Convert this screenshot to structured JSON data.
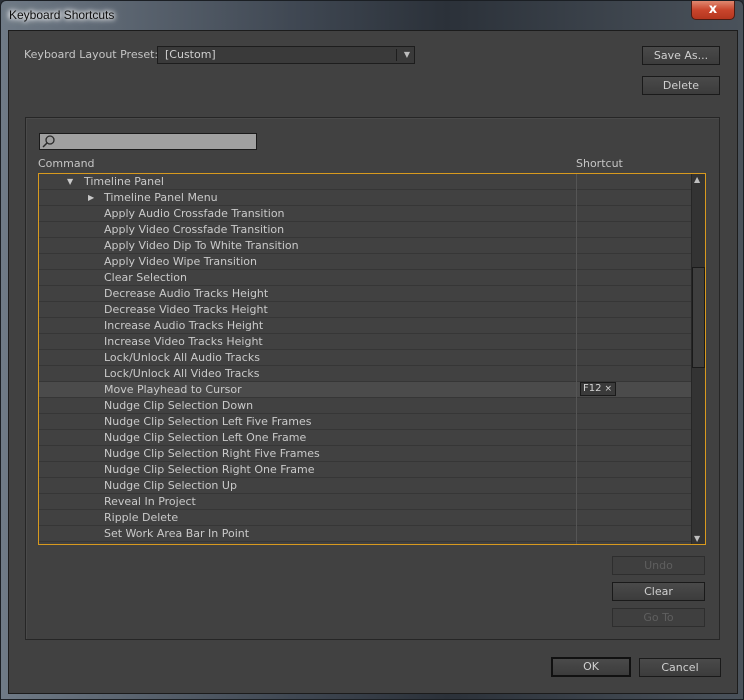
{
  "window": {
    "title": "Keyboard Shortcuts",
    "close_glyph": "x"
  },
  "preset": {
    "label": "Keyboard Layout Preset:",
    "value": "[Custom]",
    "arrow": "▼"
  },
  "buttons": {
    "save_as": "Save As...",
    "delete": "Delete",
    "undo": "Undo",
    "clear": "Clear",
    "go_to": "Go To",
    "ok": "OK",
    "cancel": "Cancel"
  },
  "search": {
    "placeholder": "",
    "value": "",
    "icon": "search-icon"
  },
  "table": {
    "columns": [
      "Command",
      "Shortcut"
    ],
    "rows": [
      {
        "command": "Timeline Panel",
        "level": 0,
        "expander": "▼",
        "shortcut": ""
      },
      {
        "command": "Timeline Panel Menu",
        "level": 1,
        "expander": "▶",
        "shortcut": ""
      },
      {
        "command": "Apply Audio Crossfade Transition",
        "level": 2,
        "shortcut": ""
      },
      {
        "command": "Apply Video Crossfade Transition",
        "level": 2,
        "shortcut": ""
      },
      {
        "command": "Apply Video Dip To White Transition",
        "level": 2,
        "shortcut": ""
      },
      {
        "command": "Apply Video Wipe Transition",
        "level": 2,
        "shortcut": ""
      },
      {
        "command": "Clear Selection",
        "level": 2,
        "shortcut": ""
      },
      {
        "command": "Decrease Audio Tracks Height",
        "level": 2,
        "shortcut": ""
      },
      {
        "command": "Decrease Video Tracks Height",
        "level": 2,
        "shortcut": ""
      },
      {
        "command": "Increase Audio Tracks Height",
        "level": 2,
        "shortcut": ""
      },
      {
        "command": "Increase Video Tracks Height",
        "level": 2,
        "shortcut": ""
      },
      {
        "command": "Lock/Unlock All Audio Tracks",
        "level": 2,
        "shortcut": ""
      },
      {
        "command": "Lock/Unlock All Video Tracks",
        "level": 2,
        "shortcut": ""
      },
      {
        "command": "Move Playhead to Cursor",
        "level": 2,
        "shortcut": "F12",
        "selected": true
      },
      {
        "command": "Nudge Clip Selection Down",
        "level": 2,
        "shortcut": ""
      },
      {
        "command": "Nudge Clip Selection Left Five Frames",
        "level": 2,
        "shortcut": ""
      },
      {
        "command": "Nudge Clip Selection Left One Frame",
        "level": 2,
        "shortcut": ""
      },
      {
        "command": "Nudge Clip Selection Right Five Frames",
        "level": 2,
        "shortcut": ""
      },
      {
        "command": "Nudge Clip Selection Right One Frame",
        "level": 2,
        "shortcut": ""
      },
      {
        "command": "Nudge Clip Selection Up",
        "level": 2,
        "shortcut": ""
      },
      {
        "command": "Reveal In Project",
        "level": 2,
        "shortcut": ""
      },
      {
        "command": "Ripple Delete",
        "level": 2,
        "shortcut": ""
      },
      {
        "command": "Set Work Area Bar In Point",
        "level": 2,
        "shortcut": ""
      }
    ],
    "shortcut_remove_glyph": "×",
    "scroll_up": "▲",
    "scroll_down": "▼"
  },
  "colors": {
    "focus_border": "#d89a1e",
    "panel_bg": "#414141"
  }
}
